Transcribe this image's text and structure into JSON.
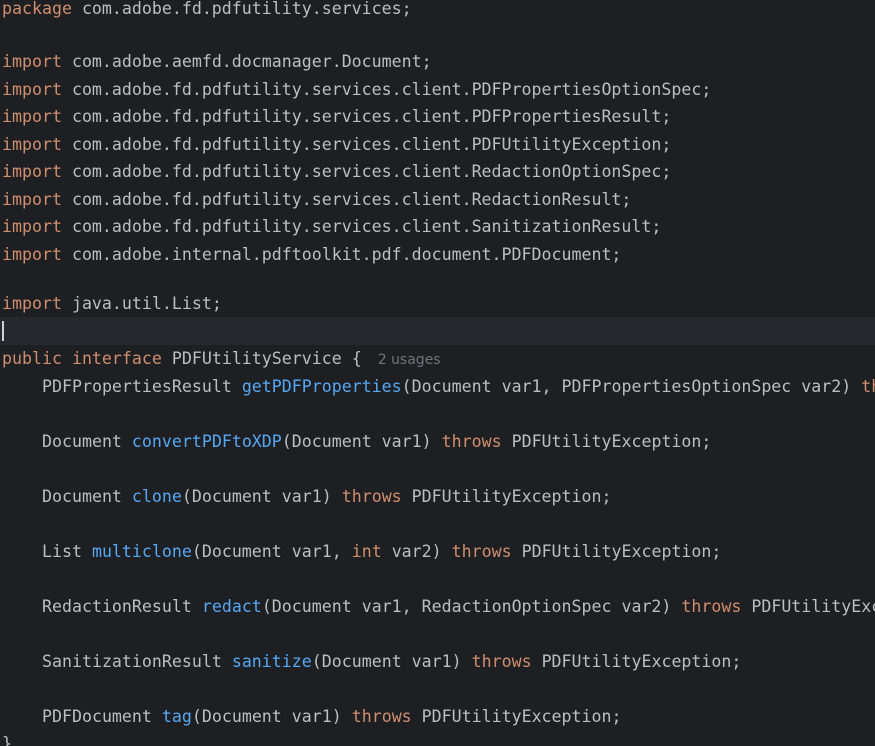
{
  "package_line": {
    "keyword": "package",
    "name": "com.adobe.fd.pdfutility.services;"
  },
  "imports": [
    {
      "keyword": "import",
      "name": "com.adobe.aemfd.docmanager.Document;"
    },
    {
      "keyword": "import",
      "name": "com.adobe.fd.pdfutility.services.client.PDFPropertiesOptionSpec;"
    },
    {
      "keyword": "import",
      "name": "com.adobe.fd.pdfutility.services.client.PDFPropertiesResult;"
    },
    {
      "keyword": "import",
      "name": "com.adobe.fd.pdfutility.services.client.PDFUtilityException;"
    },
    {
      "keyword": "import",
      "name": "com.adobe.fd.pdfutility.services.client.RedactionOptionSpec;"
    },
    {
      "keyword": "import",
      "name": "com.adobe.fd.pdfutility.services.client.RedactionResult;"
    },
    {
      "keyword": "import",
      "name": "com.adobe.fd.pdfutility.services.client.SanitizationResult;"
    },
    {
      "keyword": "import",
      "name": "com.adobe.internal.pdftoolkit.pdf.document.PDFDocument;"
    }
  ],
  "util_import": {
    "keyword": "import",
    "name": "java.util.List;"
  },
  "interface_decl": {
    "kw_public": "public",
    "kw_interface": "interface",
    "name": "PDFUtilityService {",
    "usages_hint": "2 usages"
  },
  "methods": [
    {
      "return_type": "PDFPropertiesResult ",
      "name": "getPDFProperties",
      "params_pre": "(Document var1, PDFPropertiesOptionSpec var2) ",
      "params_kw": "",
      "params_post": "",
      "throws": "th",
      "exception": ""
    },
    {
      "return_type": "Document ",
      "name": "convertPDFtoXDP",
      "params_pre": "(Document var1) ",
      "params_kw": "",
      "params_post": "",
      "throws": "throws",
      "exception": " PDFUtilityException;"
    },
    {
      "return_type": "Document ",
      "name": "clone",
      "params_pre": "(Document var1) ",
      "params_kw": "",
      "params_post": "",
      "throws": "throws",
      "exception": " PDFUtilityException;"
    },
    {
      "return_type": "List ",
      "name": "multiclone",
      "params_pre": "(Document var1, ",
      "params_kw": "int",
      "params_post": " var2) ",
      "throws": "throws",
      "exception": " PDFUtilityException;"
    },
    {
      "return_type": "RedactionResult ",
      "name": "redact",
      "params_pre": "(Document var1, RedactionOptionSpec var2) ",
      "params_kw": "",
      "params_post": "",
      "throws": "throws",
      "exception": " PDFUtilityExc"
    },
    {
      "return_type": "SanitizationResult ",
      "name": "sanitize",
      "params_pre": "(Document var1) ",
      "params_kw": "",
      "params_post": "",
      "throws": "throws",
      "exception": " PDFUtilityException;"
    },
    {
      "return_type": "PDFDocument ",
      "name": "tag",
      "params_pre": "(Document var1) ",
      "params_kw": "",
      "params_post": "",
      "throws": "throws",
      "exception": " PDFUtilityException;"
    }
  ],
  "closing_brace": "}",
  "colors": {
    "background": "#1e1f22",
    "current_line": "#26282e",
    "keyword": "#cf8e6d",
    "method": "#56a8f5",
    "text": "#bcbec4",
    "hint": "#6f737a"
  }
}
